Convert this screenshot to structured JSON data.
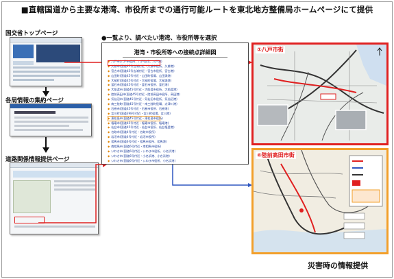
{
  "title": "■直轄国道から主要な港湾、市役所までの通行可能ルートを東北地方整備局ホームページにて提供",
  "steps": [
    {
      "label": "国交省トップページ"
    },
    {
      "label": "各局情報の集約ページ"
    },
    {
      "label": "道路関係情報提供ページ"
    }
  ],
  "list_panel": {
    "heading": "●一覧より、調べたい港湾、市役所等を選択",
    "box_title": "港湾・市役所等への接続点詳細図",
    "items": [
      "八戸市(八戸市役所、八戸港湾、八戸港)",
      "久慈市(国道45号吉浦付近・久慈市役所、久慈港)",
      "宮古市(国道45号吉浦付近・宮古市役所、宮古港)",
      "山田町(国道45号付近・山田町役場、山田漁港)",
      "大槌町(国道45号付近・大槌町役場、大槌漁港)",
      "釜石市(国道45号付近・釜石市役所、釜石港)",
      "大船渡市(国道45号付近・大船渡市役所、大船渡港)",
      "陸前高田市(国道45号付近・陸前高田市役所、高田港)",
      "気仙沼市(国道45号付近・気仙沼市役所、気仙沼港)",
      "南三陸町(国道45号付近・南三陸町役場、志津川港)",
      "石巻市(国道45号付近・石巻市役所、石巻港)",
      "女川町(国道398号付近・女川町役場、女川港)",
      "東松島市(国道45号付近・東松島市役所)",
      "塩竈市(国道45号付近・塩竈市役所、塩竈港)",
      "仙台市(国道45号付近・仙台市役所、仙台塩釜港)",
      "名取市(国道4号付近・名取市役所)",
      "岩沼市(国道4号付近・岩沼市役所)",
      "相馬市(国道6号付近・相馬市役所、相馬港)",
      "南相馬市(国道6号付近・南相馬市役所)",
      "いわき市(国道6号付近・いわき市役所、小名浜港)",
      "いわき市(国道6号付近・小名浜港、小名浜港)",
      "いわき市(国道6号付近・いわき市役所、小名浜港)"
    ]
  },
  "maps": [
    {
      "label": "①八戸市街"
    },
    {
      "label": "⑧陸前高田市街"
    }
  ],
  "footer": "災害時の情報提供",
  "colors": {
    "red": "#e02020",
    "orange": "#f29f2a",
    "link": "#1a3c9b",
    "brand": "#2b5fa8"
  }
}
